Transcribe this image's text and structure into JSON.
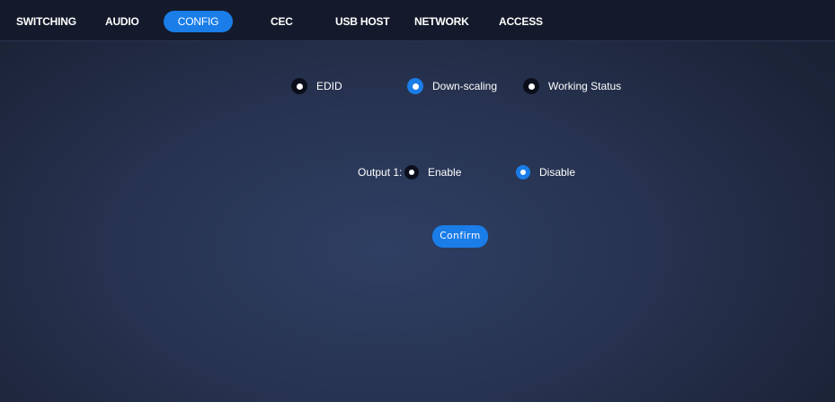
{
  "nav": {
    "tabs": [
      {
        "label": "SWITCHING",
        "active": false
      },
      {
        "label": "AUDIO",
        "active": false
      },
      {
        "label": "CONFIG",
        "active": true
      },
      {
        "label": "CEC",
        "active": false
      },
      {
        "label": "USB HOST",
        "active": false
      },
      {
        "label": "NETWORK",
        "active": false
      },
      {
        "label": "ACCESS",
        "active": false
      }
    ]
  },
  "config": {
    "subtabs": [
      {
        "label": "EDID",
        "selected": false
      },
      {
        "label": "Down-scaling",
        "selected": true
      },
      {
        "label": "Working Status",
        "selected": false
      }
    ],
    "output_label": "Output 1:",
    "options": [
      {
        "label": "Enable",
        "selected": false
      },
      {
        "label": "Disable",
        "selected": true
      }
    ],
    "confirm_label": "Confirm"
  },
  "colors": {
    "accent": "#1a7de8",
    "nav_bg": "#141a2b",
    "radio_unchecked": "#0b0f1c"
  }
}
